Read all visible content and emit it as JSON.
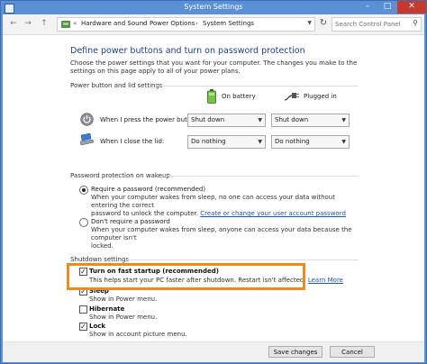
{
  "window": {
    "title": "System Settings"
  },
  "nav": {
    "back": "←",
    "forward": "→",
    "up": "↑",
    "overflow": "«",
    "crumbs": [
      "Hardware and Sound",
      "Power Options",
      "System Settings"
    ],
    "sep": "›",
    "search_placeholder": "Search Control Panel"
  },
  "page": {
    "heading": "Define power buttons and turn on password protection",
    "intro": "Choose the power settings that you want for your computer. The changes you make to the settings on this page apply to all of your power plans."
  },
  "power_buttons": {
    "group_label": "Power button and lid settings",
    "col_battery": "On battery",
    "col_plugged": "Plugged in",
    "rows": [
      {
        "label": "When I press the power button:",
        "battery": "Shut down",
        "plugged": "Shut down"
      },
      {
        "label": "When I close the lid:",
        "battery": "Do nothing",
        "plugged": "Do nothing"
      }
    ]
  },
  "password": {
    "group_label": "Password protection on wakeup",
    "require_label": "Require a password (recommended)",
    "require_desc_1": "When your computer wakes from sleep, no one can access your data without entering the correct",
    "require_desc_2": "password to unlock the computer.",
    "require_link": "Create or change your user account password",
    "norequire_label": "Don't require a password",
    "norequire_desc_1": "When your computer wakes from sleep, anyone can access your data because the computer isn't",
    "norequire_desc_2": "locked."
  },
  "shutdown": {
    "group_label": "Shutdown settings",
    "check_glyph": "✓",
    "items": [
      {
        "name": "Turn on fast startup (recommended)",
        "desc": "This helps start your PC faster after shutdown. Restart isn't affected.",
        "link": "Learn More",
        "checked": true
      },
      {
        "name": "Sleep",
        "desc": "Show in Power menu.",
        "checked": true
      },
      {
        "name": "Hibernate",
        "desc": "Show in Power menu.",
        "checked": false
      },
      {
        "name": "Lock",
        "desc": "Show in account picture menu.",
        "checked": true
      }
    ]
  },
  "buttons": {
    "save": "Save changes",
    "cancel": "Cancel"
  },
  "colors": {
    "accent": "#1e3f8c",
    "link": "#1a56b4",
    "highlight": "#f08a1c",
    "titlebar": "#5b8fd6"
  }
}
